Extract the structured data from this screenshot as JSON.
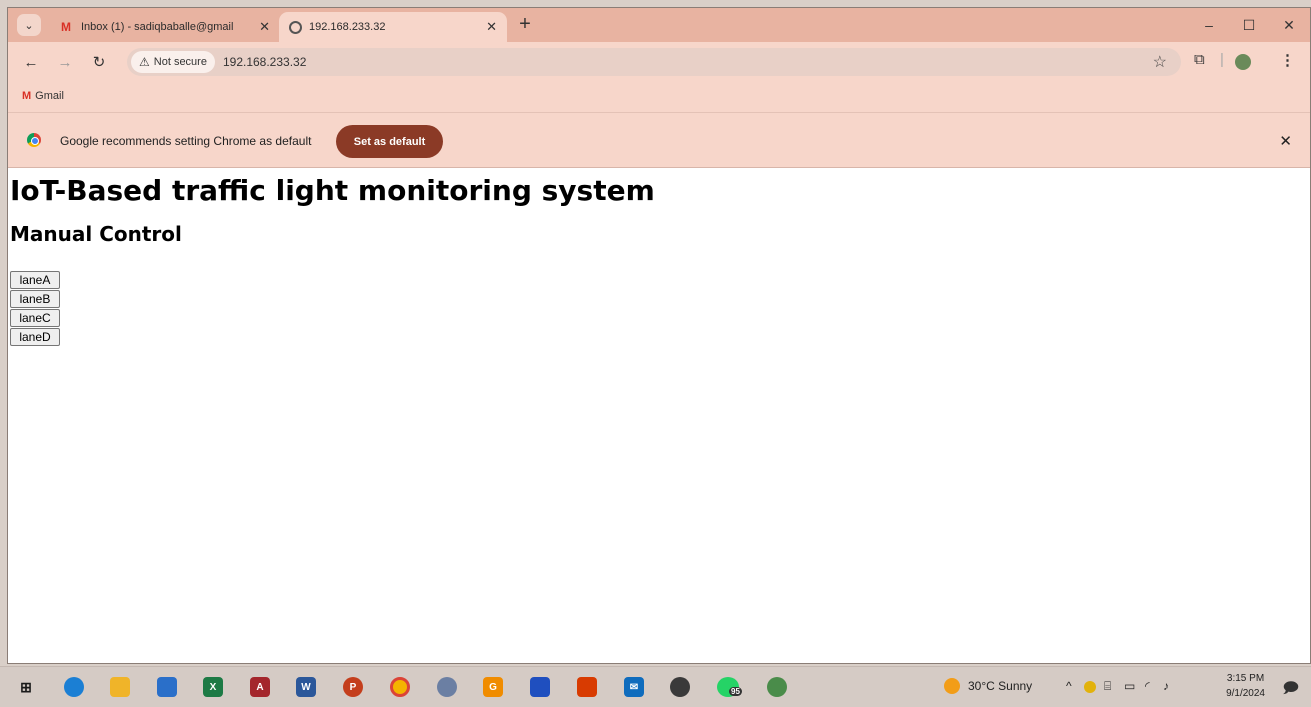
{
  "browser": {
    "tabs": [
      {
        "title": "Inbox (1) - sadiqbaballe@gmail",
        "icon": "gmail-icon",
        "active": false
      },
      {
        "title": "192.168.233.32",
        "icon": "globe-icon",
        "active": true
      }
    ],
    "address": {
      "security_label": "Not secure",
      "url": "192.168.233.32"
    },
    "bookmarks": [
      {
        "label": "Gmail"
      }
    ],
    "infobar": {
      "message": "Google recommends setting Chrome as default",
      "button_label": "Set as default"
    }
  },
  "page": {
    "title": "IoT-Based traffic light monitoring system",
    "subtitle": "Manual Control",
    "lane_buttons": [
      "laneA",
      "laneB",
      "laneC",
      "laneD"
    ]
  },
  "taskbar": {
    "weather": "30°C  Sunny",
    "whatsapp_badge": "95",
    "time": "3:15 PM",
    "date": "9/1/2024"
  },
  "colors": {
    "tabstrip": "#e8b3a1",
    "toolbar": "#f7d6ca",
    "set_default_button": "#8b3a26"
  }
}
